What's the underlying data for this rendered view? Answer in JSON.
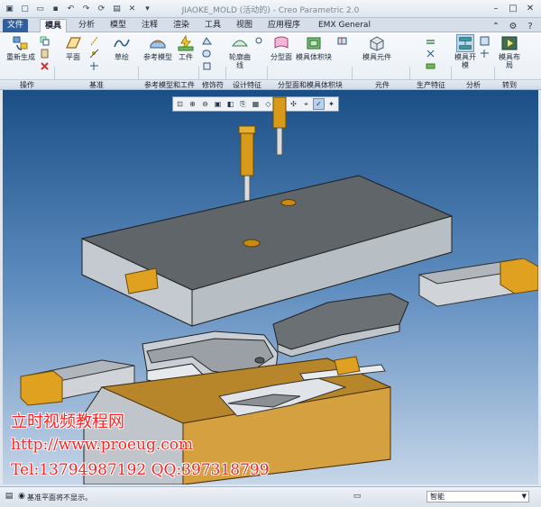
{
  "window": {
    "title": "JIAOKE_MOLD (活动的) - Creo Parametric 2.0"
  },
  "tabs": [
    "文件",
    "模具",
    "分析",
    "模型",
    "注释",
    "渲染",
    "工具",
    "视图",
    "应用程序",
    "EMX General"
  ],
  "active_tab": "模具",
  "ribbon": {
    "regen": "重新生成",
    "plane": "平面",
    "sketch": "草绘",
    "ref_model": "参考模型",
    "workpiece": "工件",
    "silhouette": "轮廓曲线",
    "parting_surface": "分型面",
    "mold_volume": "模具体积块",
    "mold_component": "模具元件",
    "mold_open": "模具开模",
    "mold_layout": "模具布局"
  },
  "groups": [
    "操作",
    "基准",
    "参考模型和工件",
    "修饰符",
    "设计特征",
    "分型面和模具体积块",
    "元件",
    "生产特征",
    "分析",
    "转到"
  ],
  "watermark": {
    "line1": "立时视频教程网",
    "line2": "http://www.proeug.com",
    "line3": "Tel:13794987192  QQ:397318799"
  },
  "status": {
    "message": "基准平面将不显示。",
    "filter": "智能"
  },
  "colors": {
    "accent": "#2f5f9e",
    "part_grey": "#6b7074",
    "part_light": "#c9cfd4",
    "insert_orange": "#e0a020",
    "watermark": "#ff2424"
  }
}
